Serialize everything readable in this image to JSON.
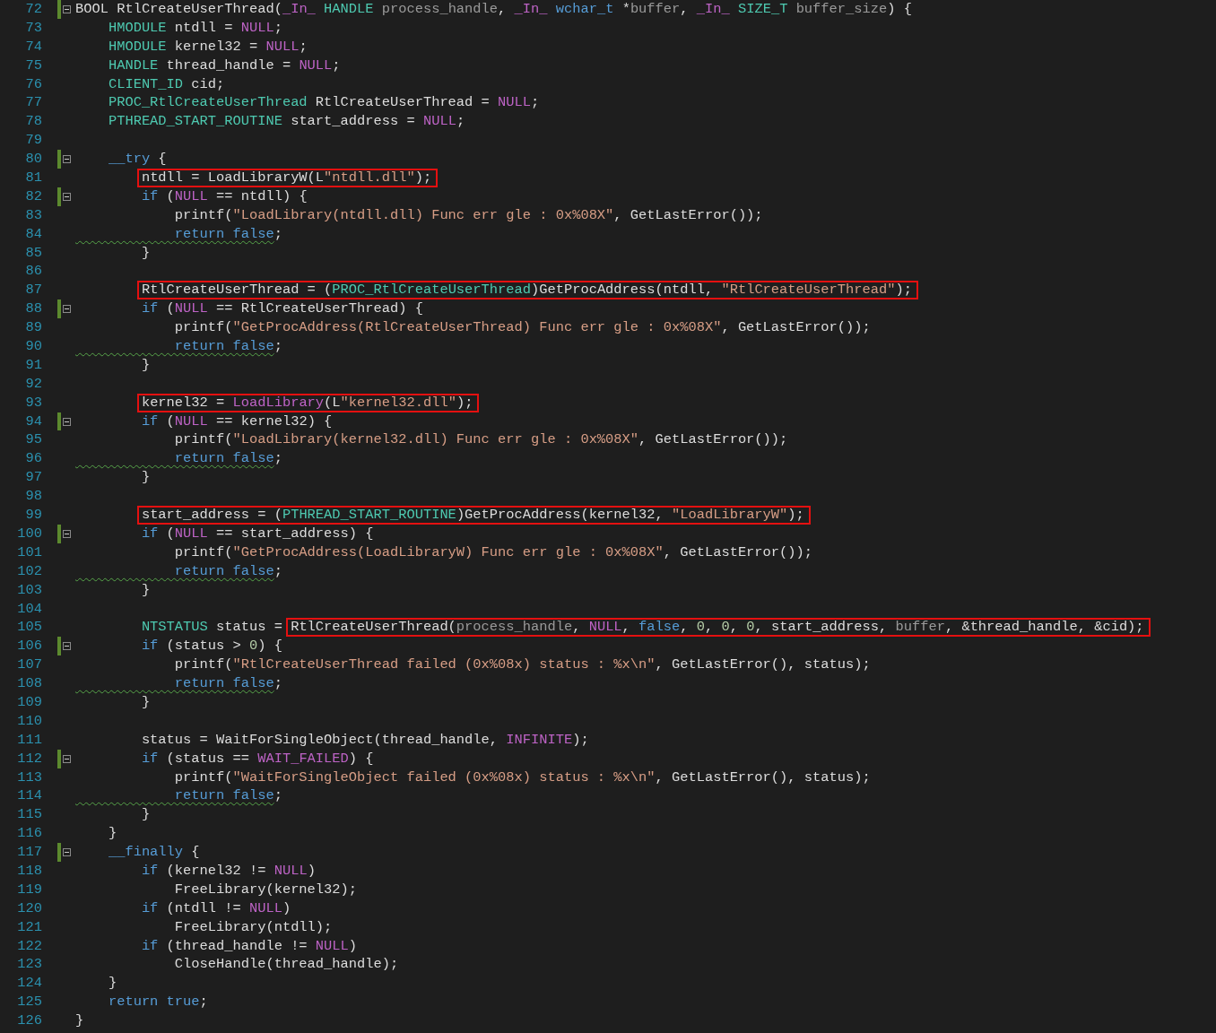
{
  "editor": {
    "lines": [
      {
        "number": "72",
        "modified": true,
        "collapsible": true,
        "tokens": [
          {
            "text": "BOOL RtlCreateUserThread(",
            "kind": "plain"
          },
          {
            "text": "_In_ ",
            "kind": "macro"
          },
          {
            "text": "HANDLE ",
            "kind": "type"
          },
          {
            "text": "process_handle",
            "kind": "param"
          },
          {
            "text": ", ",
            "kind": "plain"
          },
          {
            "text": "_In_ ",
            "kind": "macro"
          },
          {
            "text": "wchar_t",
            "kind": "keyword"
          },
          {
            "text": " *",
            "kind": "plain"
          },
          {
            "text": "buffer",
            "kind": "param"
          },
          {
            "text": ", ",
            "kind": "plain"
          },
          {
            "text": "_In_ ",
            "kind": "macro"
          },
          {
            "text": "SIZE_T ",
            "kind": "type"
          },
          {
            "text": "buffer_size",
            "kind": "param"
          },
          {
            "text": ") {",
            "kind": "plain"
          }
        ]
      },
      {
        "number": "73",
        "modified": false,
        "collapsible": false,
        "tokens": [
          {
            "text": "    HMODULE",
            "kind": "type"
          },
          {
            "text": " ntdll = ",
            "kind": "plain"
          },
          {
            "text": "NULL",
            "kind": "macro"
          },
          {
            "text": ";",
            "kind": "plain"
          }
        ]
      },
      {
        "number": "74",
        "modified": false,
        "collapsible": false,
        "tokens": [
          {
            "text": "    HMODULE",
            "kind": "type"
          },
          {
            "text": " kernel32 = ",
            "kind": "plain"
          },
          {
            "text": "NULL",
            "kind": "macro"
          },
          {
            "text": ";",
            "kind": "plain"
          }
        ]
      },
      {
        "number": "75",
        "modified": false,
        "collapsible": false,
        "tokens": [
          {
            "text": "    HANDLE",
            "kind": "type"
          },
          {
            "text": " thread_handle = ",
            "kind": "plain"
          },
          {
            "text": "NULL",
            "kind": "macro"
          },
          {
            "text": ";",
            "kind": "plain"
          }
        ]
      },
      {
        "number": "76",
        "modified": false,
        "collapsible": false,
        "tokens": [
          {
            "text": "    CLIENT_ID",
            "kind": "type"
          },
          {
            "text": " cid;",
            "kind": "plain"
          }
        ]
      },
      {
        "number": "77",
        "modified": false,
        "collapsible": false,
        "tokens": [
          {
            "text": "    PROC_RtlCreateUserThread",
            "kind": "type"
          },
          {
            "text": " RtlCreateUserThread = ",
            "kind": "plain"
          },
          {
            "text": "NULL",
            "kind": "macro"
          },
          {
            "text": ";",
            "kind": "plain"
          }
        ]
      },
      {
        "number": "78",
        "modified": false,
        "collapsible": false,
        "tokens": [
          {
            "text": "    PTHREAD_START_ROUTINE",
            "kind": "type"
          },
          {
            "text": " start_address = ",
            "kind": "plain"
          },
          {
            "text": "NULL",
            "kind": "macro"
          },
          {
            "text": ";",
            "kind": "plain"
          }
        ]
      },
      {
        "number": "79",
        "modified": false,
        "collapsible": false
      },
      {
        "number": "80",
        "modified": true,
        "collapsible": true,
        "tokens": [
          {
            "text": "    __try",
            "kind": "keyword"
          },
          {
            "text": " {",
            "kind": "plain"
          }
        ]
      },
      {
        "number": "81",
        "modified": false,
        "collapsible": false,
        "tokens": [
          {
            "kind": "box",
            "tokens": [
              {
                "text": "ntdll = LoadLibraryW(L",
                "kind": "plain"
              },
              {
                "text": "\"ntdll.dll\"",
                "kind": "string"
              },
              {
                "text": ");",
                "kind": "plain"
              }
            ]
          }
        ]
      },
      {
        "number": "82",
        "modified": true,
        "collapsible": true,
        "tokens": [
          {
            "text": "        if",
            "kind": "keyword"
          },
          {
            "text": " (",
            "kind": "plain"
          },
          {
            "text": "NULL",
            "kind": "macro"
          },
          {
            "text": " == ntdll) {",
            "kind": "plain"
          }
        ]
      },
      {
        "number": "83",
        "modified": false,
        "collapsible": false,
        "tokens": [
          {
            "text": "            printf(",
            "kind": "plain"
          },
          {
            "text": "\"LoadLibrary(ntdll.dll) Func err gle : 0x%08X\"",
            "kind": "string"
          },
          {
            "text": ", GetLastError());",
            "kind": "plain"
          }
        ]
      },
      {
        "number": "84",
        "modified": false,
        "collapsible": false,
        "tokens": [
          {
            "text": "            return false",
            "kind": "squiggled"
          },
          {
            "text": ";",
            "kind": "plain"
          }
        ]
      },
      {
        "number": "85",
        "modified": false,
        "collapsible": false,
        "tokens": [
          {
            "text": "        }",
            "kind": "plain"
          }
        ]
      },
      {
        "number": "86",
        "modified": false,
        "collapsible": false
      },
      {
        "number": "87",
        "modified": false,
        "collapsible": false,
        "tokens": [
          {
            "kind": "box",
            "tokens": [
              {
                "text": "RtlCreateUserThread = (",
                "kind": "plain"
              },
              {
                "text": "PROC_RtlCreateUserThread",
                "kind": "type"
              },
              {
                "text": ")GetProcAddress(ntdll, ",
                "kind": "plain"
              },
              {
                "text": "\"RtlCreateUserThread\"",
                "kind": "string"
              },
              {
                "text": ");",
                "kind": "plain"
              }
            ]
          }
        ]
      },
      {
        "number": "88",
        "modified": true,
        "collapsible": true,
        "tokens": [
          {
            "text": "        if",
            "kind": "keyword"
          },
          {
            "text": " (",
            "kind": "plain"
          },
          {
            "text": "NULL",
            "kind": "macro"
          },
          {
            "text": " == RtlCreateUserThread) {",
            "kind": "plain"
          }
        ]
      },
      {
        "number": "89",
        "modified": false,
        "collapsible": false,
        "tokens": [
          {
            "text": "            printf(",
            "kind": "plain"
          },
          {
            "text": "\"GetProcAddress(RtlCreateUserThread) Func err gle : 0x%08X\"",
            "kind": "string"
          },
          {
            "text": ", GetLastError());",
            "kind": "plain"
          }
        ]
      },
      {
        "number": "90",
        "modified": false,
        "collapsible": false,
        "tokens": [
          {
            "text": "            return false",
            "kind": "squiggled"
          },
          {
            "text": ";",
            "kind": "plain"
          }
        ]
      },
      {
        "number": "91",
        "modified": false,
        "collapsible": false,
        "tokens": [
          {
            "text": "        }",
            "kind": "plain"
          }
        ]
      },
      {
        "number": "92",
        "modified": false,
        "collapsible": false
      },
      {
        "number": "93",
        "modified": false,
        "collapsible": false,
        "tokens": [
          {
            "kind": "box",
            "tokens": [
              {
                "text": "kernel32 = ",
                "kind": "plain"
              },
              {
                "text": "LoadLibrary",
                "kind": "macro"
              },
              {
                "text": "(L",
                "kind": "plain"
              },
              {
                "text": "\"kernel32.dll\"",
                "kind": "string"
              },
              {
                "text": ");",
                "kind": "plain"
              }
            ]
          }
        ]
      },
      {
        "number": "94",
        "modified": true,
        "collapsible": true,
        "tokens": [
          {
            "text": "        if",
            "kind": "keyword"
          },
          {
            "text": " (",
            "kind": "plain"
          },
          {
            "text": "NULL",
            "kind": "macro"
          },
          {
            "text": " == kernel32) {",
            "kind": "plain"
          }
        ]
      },
      {
        "number": "95",
        "modified": false,
        "collapsible": false,
        "tokens": [
          {
            "text": "            printf(",
            "kind": "plain"
          },
          {
            "text": "\"LoadLibrary(kernel32.dll) Func err gle : 0x%08X\"",
            "kind": "string"
          },
          {
            "text": ", GetLastError());",
            "kind": "plain"
          }
        ]
      },
      {
        "number": "96",
        "modified": false,
        "collapsible": false,
        "tokens": [
          {
            "text": "            return false",
            "kind": "squiggled"
          },
          {
            "text": ";",
            "kind": "plain"
          }
        ]
      },
      {
        "number": "97",
        "modified": false,
        "collapsible": false,
        "tokens": [
          {
            "text": "        }",
            "kind": "plain"
          }
        ]
      },
      {
        "number": "98",
        "modified": false,
        "collapsible": false
      },
      {
        "number": "99",
        "modified": false,
        "collapsible": false,
        "tokens": [
          {
            "kind": "box",
            "tokens": [
              {
                "text": "start_address = (",
                "kind": "plain"
              },
              {
                "text": "PTHREAD_START_ROUTINE",
                "kind": "type"
              },
              {
                "text": ")GetProcAddress(kernel32, ",
                "kind": "plain"
              },
              {
                "text": "\"LoadLibraryW\"",
                "kind": "string"
              },
              {
                "text": ");",
                "kind": "plain"
              }
            ]
          }
        ]
      },
      {
        "number": "100",
        "modified": true,
        "collapsible": true,
        "tokens": [
          {
            "text": "        if",
            "kind": "keyword"
          },
          {
            "text": " (",
            "kind": "plain"
          },
          {
            "text": "NULL",
            "kind": "macro"
          },
          {
            "text": " == start_address) {",
            "kind": "plain"
          }
        ]
      },
      {
        "number": "101",
        "modified": false,
        "collapsible": false,
        "tokens": [
          {
            "text": "            printf(",
            "kind": "plain"
          },
          {
            "text": "\"GetProcAddress(LoadLibraryW) Func err gle : 0x%08X\"",
            "kind": "string"
          },
          {
            "text": ", GetLastError());",
            "kind": "plain"
          }
        ]
      },
      {
        "number": "102",
        "modified": false,
        "collapsible": false,
        "tokens": [
          {
            "text": "            return false",
            "kind": "squiggled"
          },
          {
            "text": ";",
            "kind": "plain"
          }
        ]
      },
      {
        "number": "103",
        "modified": false,
        "collapsible": false,
        "tokens": [
          {
            "text": "        }",
            "kind": "plain"
          }
        ]
      },
      {
        "number": "104",
        "modified": false,
        "collapsible": false
      },
      {
        "number": "105",
        "modified": false,
        "collapsible": false,
        "tokens": [
          {
            "text": "        NTSTATUS",
            "kind": "type"
          },
          {
            "text": " status = ",
            "kind": "plain"
          },
          {
            "kind": "box",
            "tokens": [
              {
                "text": "RtlCreateUserThread(",
                "kind": "plain"
              },
              {
                "text": "process_handle",
                "kind": "param"
              },
              {
                "text": ", ",
                "kind": "plain"
              },
              {
                "text": "NULL",
                "kind": "macro"
              },
              {
                "text": ", ",
                "kind": "plain"
              },
              {
                "text": "false",
                "kind": "keyword"
              },
              {
                "text": ", ",
                "kind": "plain"
              },
              {
                "text": "0",
                "kind": "number"
              },
              {
                "text": ", ",
                "kind": "plain"
              },
              {
                "text": "0",
                "kind": "number"
              },
              {
                "text": ", ",
                "kind": "plain"
              },
              {
                "text": "0",
                "kind": "number"
              },
              {
                "text": ", start_address, ",
                "kind": "plain"
              },
              {
                "text": "buffer",
                "kind": "param"
              },
              {
                "text": ", &thread_handle, &cid);",
                "kind": "plain"
              }
            ]
          }
        ]
      },
      {
        "number": "106",
        "modified": true,
        "collapsible": true,
        "tokens": [
          {
            "text": "        if",
            "kind": "keyword"
          },
          {
            "text": " (status > ",
            "kind": "plain"
          },
          {
            "text": "0",
            "kind": "number"
          },
          {
            "text": ") {",
            "kind": "plain"
          }
        ]
      },
      {
        "number": "107",
        "modified": false,
        "collapsible": false,
        "tokens": [
          {
            "text": "            printf(",
            "kind": "plain"
          },
          {
            "text": "\"RtlCreateUserThread failed (0x%08x) status : %x\\n\"",
            "kind": "string"
          },
          {
            "text": ", GetLastError(), status);",
            "kind": "plain"
          }
        ]
      },
      {
        "number": "108",
        "modified": false,
        "collapsible": false,
        "tokens": [
          {
            "text": "            return false",
            "kind": "squiggled"
          },
          {
            "text": ";",
            "kind": "plain"
          }
        ]
      },
      {
        "number": "109",
        "modified": false,
        "collapsible": false,
        "tokens": [
          {
            "text": "        }",
            "kind": "plain"
          }
        ]
      },
      {
        "number": "110",
        "modified": false,
        "collapsible": false
      },
      {
        "number": "111",
        "modified": false,
        "collapsible": false,
        "tokens": [
          {
            "text": "        status = WaitForSingleObject(thread_handle, ",
            "kind": "plain"
          },
          {
            "text": "INFINITE",
            "kind": "macro"
          },
          {
            "text": ");",
            "kind": "plain"
          }
        ]
      },
      {
        "number": "112",
        "modified": true,
        "collapsible": true,
        "tokens": [
          {
            "text": "        if",
            "kind": "keyword"
          },
          {
            "text": " (status == ",
            "kind": "plain"
          },
          {
            "text": "WAIT_FAILED",
            "kind": "macro"
          },
          {
            "text": ") {",
            "kind": "plain"
          }
        ]
      },
      {
        "number": "113",
        "modified": false,
        "collapsible": false,
        "tokens": [
          {
            "text": "            printf(",
            "kind": "plain"
          },
          {
            "text": "\"WaitForSingleObject failed (0x%08x) status : %x\\n\"",
            "kind": "string"
          },
          {
            "text": ", GetLastError(), status);",
            "kind": "plain"
          }
        ]
      },
      {
        "number": "114",
        "modified": false,
        "collapsible": false,
        "tokens": [
          {
            "text": "            return false",
            "kind": "squiggled"
          },
          {
            "text": ";",
            "kind": "plain"
          }
        ]
      },
      {
        "number": "115",
        "modified": false,
        "collapsible": false,
        "tokens": [
          {
            "text": "        }",
            "kind": "plain"
          }
        ]
      },
      {
        "number": "116",
        "modified": false,
        "collapsible": false,
        "tokens": [
          {
            "text": "    }",
            "kind": "plain"
          }
        ]
      },
      {
        "number": "117",
        "modified": true,
        "collapsible": true,
        "tokens": [
          {
            "text": "    __finally",
            "kind": "keyword"
          },
          {
            "text": " {",
            "kind": "plain"
          }
        ]
      },
      {
        "number": "118",
        "modified": false,
        "collapsible": false,
        "tokens": [
          {
            "text": "        if",
            "kind": "keyword"
          },
          {
            "text": " (kernel32 != ",
            "kind": "plain"
          },
          {
            "text": "NULL",
            "kind": "macro"
          },
          {
            "text": ")",
            "kind": "plain"
          }
        ]
      },
      {
        "number": "119",
        "modified": false,
        "collapsible": false,
        "tokens": [
          {
            "text": "            FreeLibrary(kernel32);",
            "kind": "plain"
          }
        ]
      },
      {
        "number": "120",
        "modified": false,
        "collapsible": false,
        "tokens": [
          {
            "text": "        if",
            "kind": "keyword"
          },
          {
            "text": " (ntdll != ",
            "kind": "plain"
          },
          {
            "text": "NULL",
            "kind": "macro"
          },
          {
            "text": ")",
            "kind": "plain"
          }
        ]
      },
      {
        "number": "121",
        "modified": false,
        "collapsible": false,
        "tokens": [
          {
            "text": "            FreeLibrary(ntdll);",
            "kind": "plain"
          }
        ]
      },
      {
        "number": "122",
        "modified": false,
        "collapsible": false,
        "tokens": [
          {
            "text": "        if",
            "kind": "keyword"
          },
          {
            "text": " (thread_handle != ",
            "kind": "plain"
          },
          {
            "text": "NULL",
            "kind": "macro"
          },
          {
            "text": ")",
            "kind": "plain"
          }
        ]
      },
      {
        "number": "123",
        "modified": false,
        "collapsible": false,
        "tokens": [
          {
            "text": "            CloseHandle(thread_handle);",
            "kind": "plain"
          }
        ]
      },
      {
        "number": "124",
        "modified": false,
        "collapsible": false,
        "tokens": [
          {
            "text": "    }",
            "kind": "plain"
          }
        ]
      },
      {
        "number": "125",
        "modified": false,
        "collapsible": false,
        "tokens": [
          {
            "text": "    return true",
            "kind": "keyword"
          },
          {
            "text": ";",
            "kind": "plain"
          }
        ]
      },
      {
        "number": "126",
        "modified": false,
        "collapsible": false,
        "tokens": [
          {
            "text": "}",
            "kind": "plain"
          }
        ]
      }
    ]
  }
}
